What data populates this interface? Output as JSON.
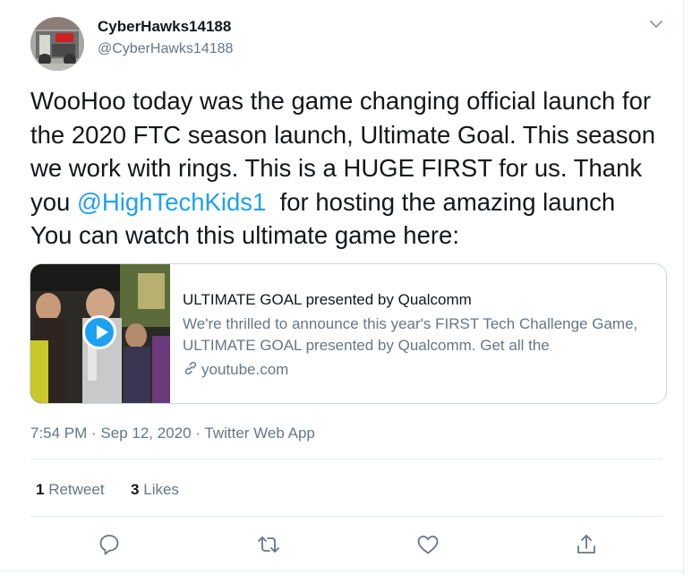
{
  "user": {
    "name": "CyberHawks14188",
    "handle": "@CyberHawks14188"
  },
  "tweet": {
    "text_before": "WooHoo today was the game changing official launch for the 2020 FTC season launch, Ultimate Goal. This season we work with rings. This is a HUGE FIRST for us. Thank you ",
    "mention": "@HighTechKids1",
    "text_after": "  for hosting the amazing launch You can watch this ultimate game here:"
  },
  "card": {
    "title": "ULTIMATE GOAL presented by Qualcomm",
    "description": "We're thrilled to announce this year's FIRST Tech Challenge Game, ULTIMATE GOAL presented by Qualcomm. Get all the",
    "domain": "youtube.com"
  },
  "meta": {
    "time": "7:54 PM",
    "sep1": " · ",
    "date": "Sep 12, 2020",
    "sep2": " · ",
    "source": "Twitter Web App"
  },
  "stats": {
    "retweets_count": "1",
    "retweets_label": "Retweet",
    "likes_count": "3",
    "likes_label": "Likes"
  },
  "icons": {
    "caret": "chevron-down-icon",
    "reply": "reply-icon",
    "retweet": "retweet-icon",
    "like": "heart-icon",
    "share": "share-icon",
    "link": "link-icon",
    "play": "play-icon"
  },
  "colors": {
    "accent": "#1da1f2",
    "secondary_text": "#657786",
    "border": "#ccd6dd"
  }
}
